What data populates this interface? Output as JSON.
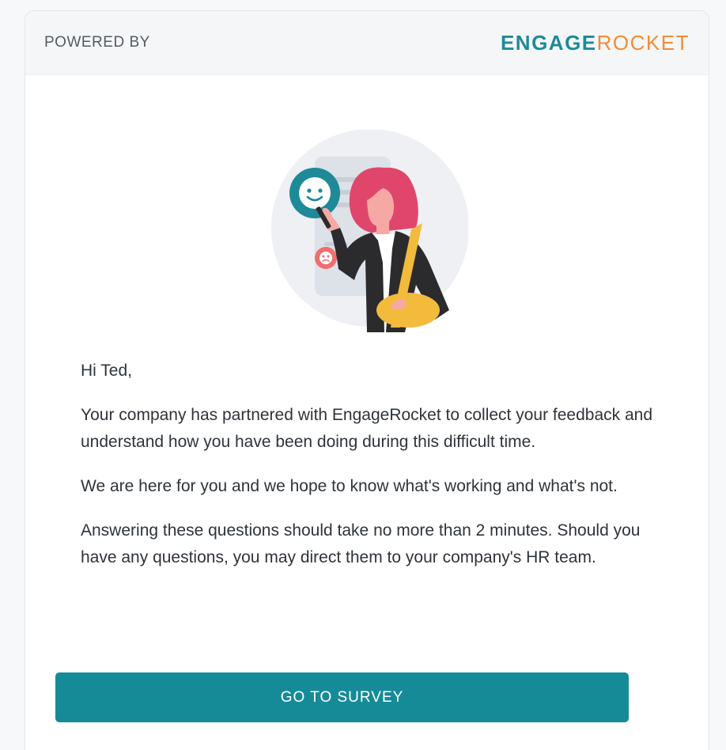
{
  "header": {
    "powered_by": "POWERED BY",
    "logo": {
      "part1": "ENGAGE",
      "part2": "ROCKET"
    }
  },
  "illustration": {
    "icon": "woman-with-phone-feedback-illustration",
    "colors": {
      "teal": "#1e8a98",
      "hair": "#e0466b",
      "coral": "#f26d6d",
      "bag": "#f2bb3c",
      "jacket": "#2b2b2e"
    }
  },
  "message": {
    "greeting": "Hi Ted,",
    "paragraphs": [
      "Your company has partnered with EngageRocket to collect your feedback and understand how you have been doing during this difficult time.",
      "We are here for you and we hope to know what's working and what's not.",
      "Answering these questions should take no more than 2 minutes. Should you have any questions, you may direct them to your company's HR team."
    ]
  },
  "cta": {
    "label": "GO TO SURVEY"
  },
  "colors": {
    "accent": "#168b98",
    "brand_orange": "#f28c38"
  }
}
